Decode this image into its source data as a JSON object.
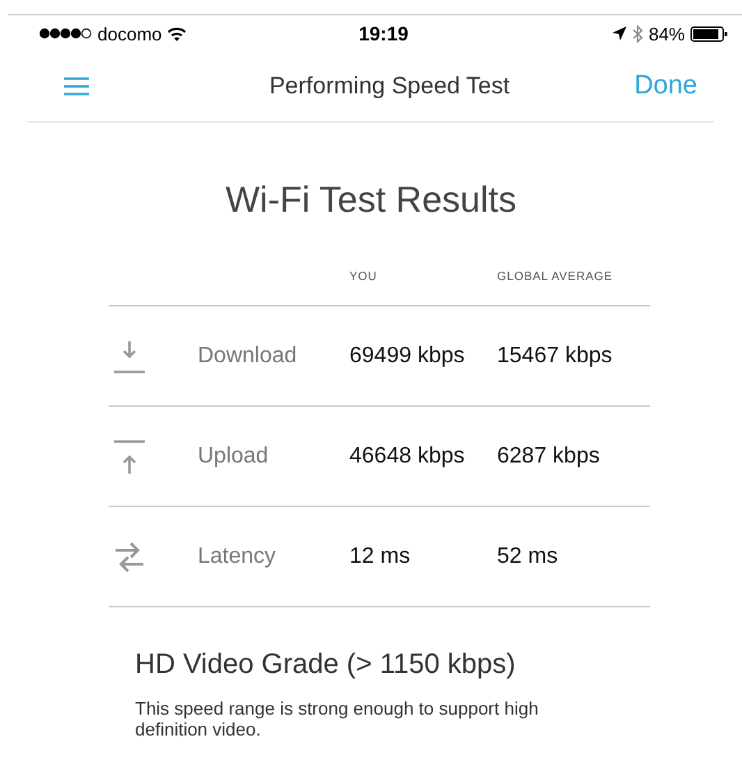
{
  "status_bar": {
    "carrier": "docomo",
    "time": "19:19",
    "battery": "84%"
  },
  "nav": {
    "title": "Performing Speed Test",
    "done": "Done"
  },
  "title": "Wi-Fi Test Results",
  "table": {
    "columns": [
      "YOU",
      "GLOBAL AVERAGE"
    ],
    "rows": [
      {
        "kind": "download",
        "label": "Download",
        "you": "69499 kbps",
        "average": "15467 kbps"
      },
      {
        "kind": "upload",
        "label": "Upload",
        "you": "46648 kbps",
        "average": "6287 kbps"
      },
      {
        "kind": "latency",
        "label": "Latency",
        "you": "12 ms",
        "average": "52 ms"
      }
    ]
  },
  "grade": {
    "heading": "HD Video Grade (> 1150 kbps)",
    "description": "This speed range is strong enough to support high definition video."
  }
}
